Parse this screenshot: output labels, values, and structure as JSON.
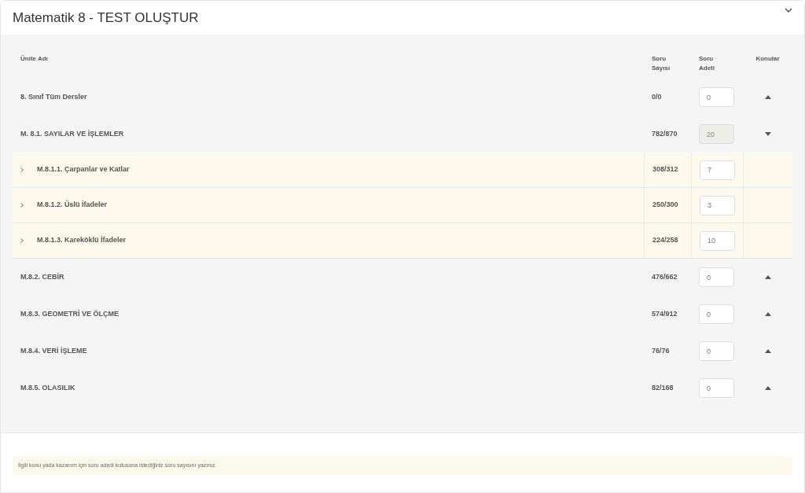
{
  "title": "Matematik 8 - TEST OLUŞTUR",
  "table": {
    "columns": [
      "Ünite Adı",
      "Soru Sayısı",
      "Soru Adeti",
      "Konular"
    ],
    "rows": [
      {
        "name": "8. Sınıf Tüm Dersler",
        "count": "0/0",
        "amount": "0",
        "disabled": false,
        "expanded": false,
        "children": []
      },
      {
        "name": "M. 8.1. SAYILAR VE İŞLEMLER",
        "count": "782/870",
        "amount": "20",
        "disabled": true,
        "expanded": true,
        "children": [
          {
            "name": "M.8.1.1. Çarpanlar ve Katlar",
            "count": "308/312",
            "amount": "7"
          },
          {
            "name": "M.8.1.2. Üslü İfadeler",
            "count": "250/300",
            "amount": "3"
          },
          {
            "name": "M.8.1.3. Kareköklü İfadeler",
            "count": "224/258",
            "amount": "10"
          }
        ]
      },
      {
        "name": "M.8.2. CEBİR",
        "count": "476/662",
        "amount": "0",
        "disabled": false,
        "expanded": false,
        "children": []
      },
      {
        "name": "M.8.3. GEOMETRİ VE ÖLÇME",
        "count": "574/912",
        "amount": "0",
        "disabled": false,
        "expanded": false,
        "children": []
      },
      {
        "name": "M.8.4. VERİ İŞLEME",
        "count": "76/76",
        "amount": "0",
        "disabled": false,
        "expanded": false,
        "children": []
      },
      {
        "name": "M.8.5. OLASILIK",
        "count": "82/168",
        "amount": "0",
        "disabled": false,
        "expanded": false,
        "children": []
      }
    ]
  },
  "note": "İlgili konu yada kazanım için soru adedi kutusuna istediğiniz soru sayısını yazınız."
}
